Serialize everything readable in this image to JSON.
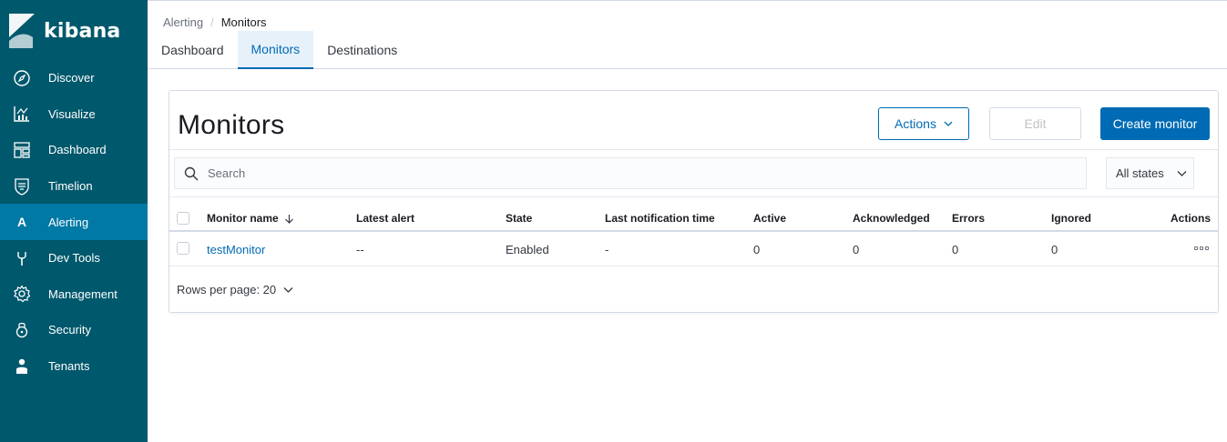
{
  "app": {
    "name": "kibana"
  },
  "sidebar": {
    "items": [
      {
        "label": "Discover",
        "icon": "compass-icon"
      },
      {
        "label": "Visualize",
        "icon": "chart-icon"
      },
      {
        "label": "Dashboard",
        "icon": "dashboard-icon"
      },
      {
        "label": "Timelion",
        "icon": "shield-icon"
      },
      {
        "label": "Alerting",
        "icon": "alerting-letter",
        "letter": "A",
        "active": true
      },
      {
        "label": "Dev Tools",
        "icon": "wrench-icon"
      },
      {
        "label": "Management",
        "icon": "gear-icon"
      },
      {
        "label": "Security",
        "icon": "lock-icon"
      },
      {
        "label": "Tenants",
        "icon": "user-icon"
      }
    ]
  },
  "breadcrumbs": {
    "parent": "Alerting",
    "current": "Monitors"
  },
  "tabs": [
    {
      "label": "Dashboard"
    },
    {
      "label": "Monitors",
      "active": true
    },
    {
      "label": "Destinations"
    }
  ],
  "panel": {
    "title": "Monitors",
    "actions_button": "Actions",
    "edit_button": "Edit",
    "create_button": "Create monitor",
    "search_placeholder": "Search",
    "state_filter": "All states"
  },
  "table": {
    "columns": [
      "Monitor name",
      "Latest alert",
      "State",
      "Last notification time",
      "Active",
      "Acknowledged",
      "Errors",
      "Ignored",
      "Actions"
    ],
    "rows": [
      {
        "monitor_name": "testMonitor",
        "latest_alert": "--",
        "state": "Enabled",
        "last_notification_time": "-",
        "active": "0",
        "acknowledged": "0",
        "errors": "0",
        "ignored": "0"
      }
    ]
  },
  "pagination": {
    "rows_per_page": "Rows per page: 20"
  },
  "colors": {
    "sidebar_bg": "#00586c",
    "sidebar_active": "#0079a5",
    "primary": "#006bb4"
  }
}
